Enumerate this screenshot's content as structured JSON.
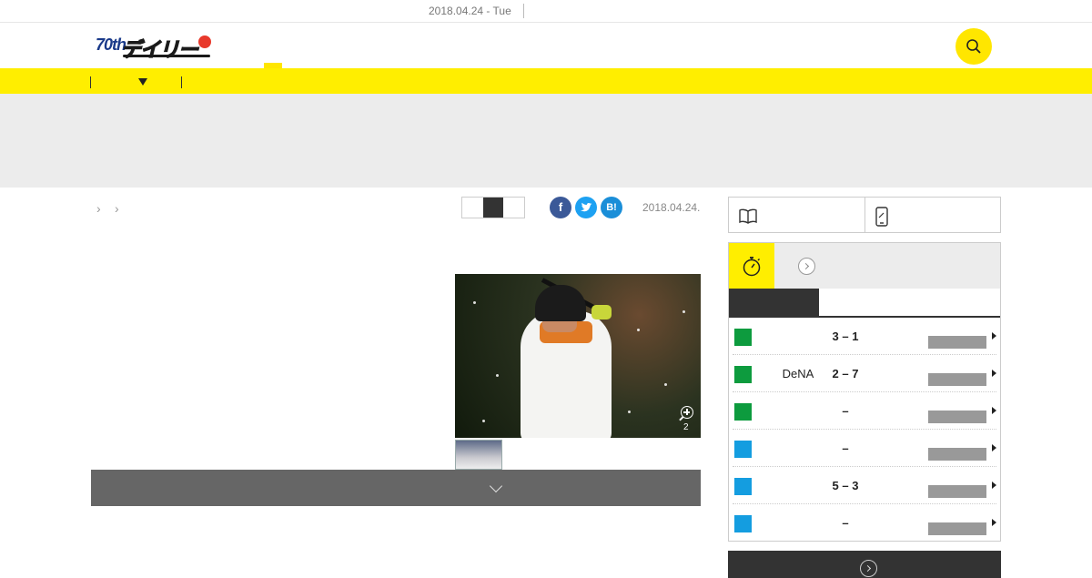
{
  "topbar": {
    "date": "2018.04.24 - Tue"
  },
  "header": {
    "logo_num": "70th",
    "logo_text": "デイリー"
  },
  "article": {
    "date": "2018.04.24.",
    "photo_count": "2"
  },
  "share": {
    "facebook": "f",
    "twitter": "t",
    "hatena": "B!"
  },
  "scoreboard": {
    "games": [
      {
        "team": "",
        "score": "3 – 1",
        "color": "#0d9b3e"
      },
      {
        "team": "DeNA",
        "score": "2 – 7",
        "color": "#0d9b3e"
      },
      {
        "team": "",
        "score": "–",
        "color": "#0d9b3e"
      },
      {
        "team": "",
        "score": "–",
        "color": "#149de0"
      },
      {
        "team": "",
        "score": "5 – 3",
        "color": "#149de0"
      },
      {
        "team": "",
        "score": "–",
        "color": "#149de0"
      }
    ]
  },
  "colors": {
    "accent_yellow": "#ffee00",
    "dark": "#333333",
    "central_league": "#0d9b3e",
    "pacific_league": "#149de0"
  },
  "icons": {
    "search": "search-icon",
    "stopwatch": "stopwatch-icon",
    "book": "book-icon",
    "smartphone": "smartphone-icon",
    "zoom": "zoom-icon"
  }
}
